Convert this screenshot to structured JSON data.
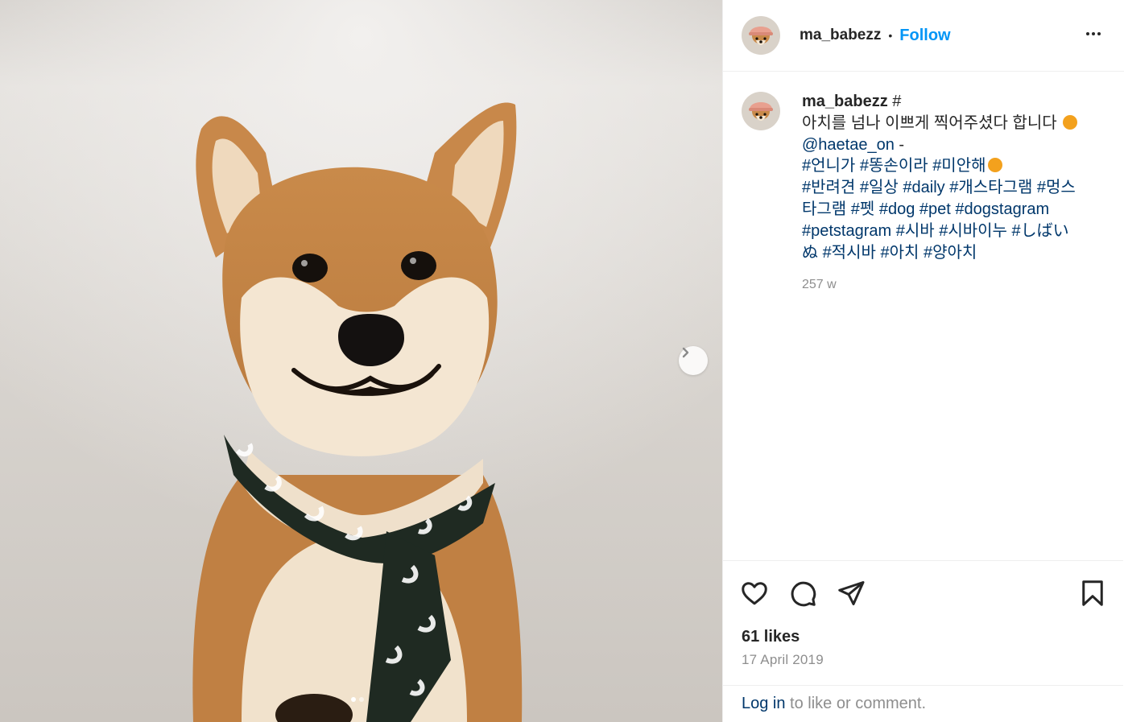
{
  "post": {
    "username": "ma_babezz",
    "separator": "•",
    "follow_label": "Follow",
    "caption": {
      "username": "ma_babezz",
      "user_suffix": "#",
      "text_line": "아치를 넘나 이쁘게 찍어주셨다 합니다",
      "mention": "@haetae_on",
      "after_mention": "-",
      "tags": [
        "#언니가",
        "#똥손이라",
        "#미안해",
        "#반려견",
        "#일상",
        "#daily",
        "#개스타그램",
        "#멍스타그램",
        "#펫",
        "#dog",
        "#pet",
        "#dogstagram",
        "#petstagram",
        "#시바",
        "#시바이누",
        "#しばいぬ",
        "#적시바",
        "#아치",
        "#양아치"
      ],
      "time_ago": "257 w"
    },
    "likes_text": "61 likes",
    "date_text": "17 April 2019",
    "login": {
      "link": "Log in",
      "text": " to like or comment."
    },
    "carousel": {
      "total": 2,
      "active_index": 0
    },
    "colors": {
      "accent": "#0095f6",
      "link": "#00376b",
      "muted": "#8e8e8e",
      "border": "#efefef"
    },
    "icons": [
      "more-options-icon",
      "heart-icon",
      "comment-icon",
      "share-icon",
      "bookmark-icon",
      "chevron-right-icon"
    ]
  }
}
